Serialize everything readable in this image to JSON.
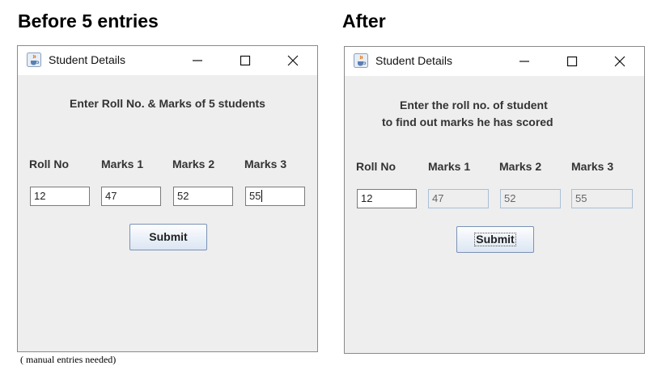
{
  "captions": {
    "before": "Before 5 entries",
    "after": "After"
  },
  "windows": {
    "before": {
      "title": "Student Details",
      "heading": "Enter Roll No. & Marks of 5 students",
      "columns": [
        "Roll No",
        "Marks 1",
        "Marks 2",
        "Marks 3"
      ],
      "fields": [
        "12",
        "47",
        "52",
        "55"
      ],
      "submit_label": "Submit"
    },
    "after": {
      "title": "Student Details",
      "heading_line1": "Enter the roll no. of student",
      "heading_line2": "to find out marks he has scored",
      "columns": [
        "Roll No",
        "Marks 1",
        "Marks 2",
        "Marks 3"
      ],
      "fields": [
        "12",
        "47",
        "52",
        "55"
      ],
      "submit_label": "Submit"
    }
  },
  "note": "( manual entries needed)",
  "icons": {
    "app": "java-cup-icon",
    "minimize": "minimize-icon",
    "maximize": "maximize-icon",
    "close": "close-icon"
  },
  "colors": {
    "window_bg": "#eeeeee",
    "titlebar_bg": "#ffffff",
    "button_border": "#7a92b4",
    "disabled_border": "#a9bfd6"
  }
}
